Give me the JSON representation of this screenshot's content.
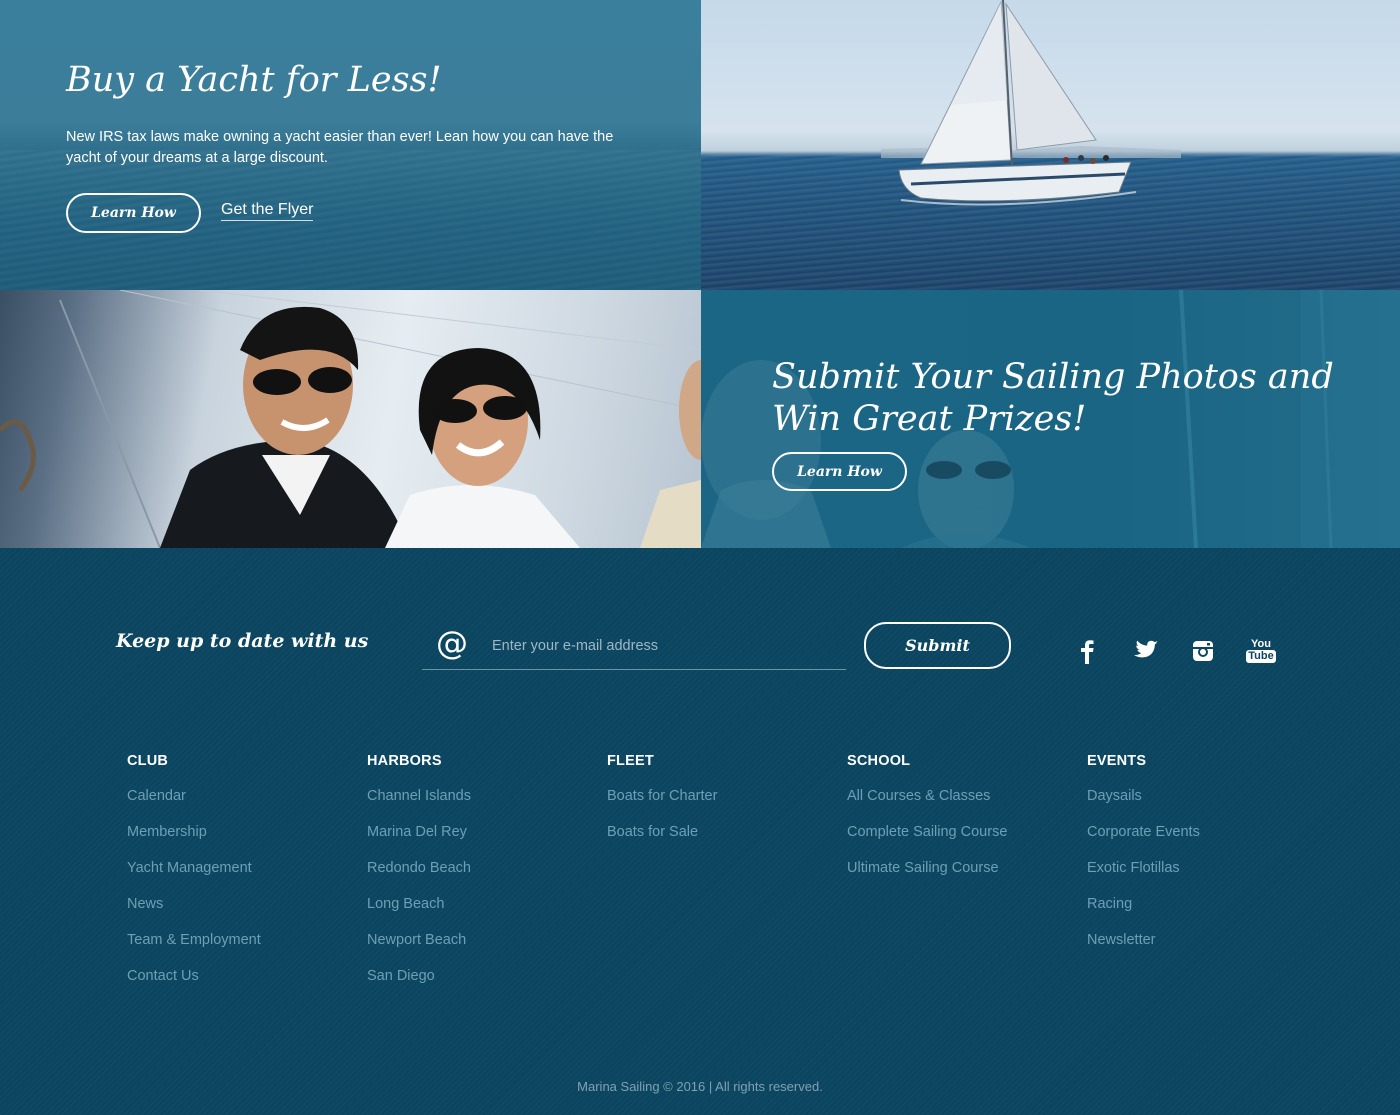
{
  "promo_yacht": {
    "title": "Buy a Yacht for Less!",
    "text": "New IRS tax laws make owning a yacht easier than ever! Lean how you can have the yacht of your dreams at a large discount.",
    "button_label": "Learn How",
    "link_label": "Get the Flyer"
  },
  "promo_photos": {
    "title_line1": "Submit Your Sailing Photos and",
    "title_line2": "Win Great Prizes!",
    "button_label": "Learn How"
  },
  "newsletter": {
    "heading": "Keep up to date with us",
    "at_symbol": "@",
    "email_placeholder": "Enter your e-mail address",
    "email_value": "",
    "submit_label": "Submit"
  },
  "social": [
    {
      "icon": "facebook-icon"
    },
    {
      "icon": "twitter-icon"
    },
    {
      "icon": "instagram-icon"
    },
    {
      "icon": "youtube-icon",
      "text_top": "You",
      "text_bottom": "Tube"
    }
  ],
  "footer_columns": [
    {
      "heading": "CLUB",
      "links": [
        "Calendar",
        "Membership",
        "Yacht Management",
        "News",
        "Team & Employment",
        "Contact Us"
      ]
    },
    {
      "heading": "HARBORS",
      "links": [
        "Channel Islands",
        "Marina Del Rey",
        "Redondo Beach",
        "Long Beach",
        "Newport Beach",
        "San Diego"
      ]
    },
    {
      "heading": "FLEET",
      "links": [
        "Boats for Charter",
        "Boats for Sale"
      ]
    },
    {
      "heading": "SCHOOL",
      "links": [
        "All Courses & Classes",
        "Complete Sailing Course",
        "Ultimate Sailing Course"
      ]
    },
    {
      "heading": "EVENTS",
      "links": [
        "Daysails",
        "Corporate Events",
        "Exotic Flotillas",
        "Racing",
        "Newsletter"
      ]
    }
  ],
  "copyright": "Marina Sailing © 2016 | All rights reserved.",
  "colors": {
    "footer_bg": "#0b4560",
    "link": "#6f9fb6",
    "promo_teal": "#3a7f9c"
  }
}
